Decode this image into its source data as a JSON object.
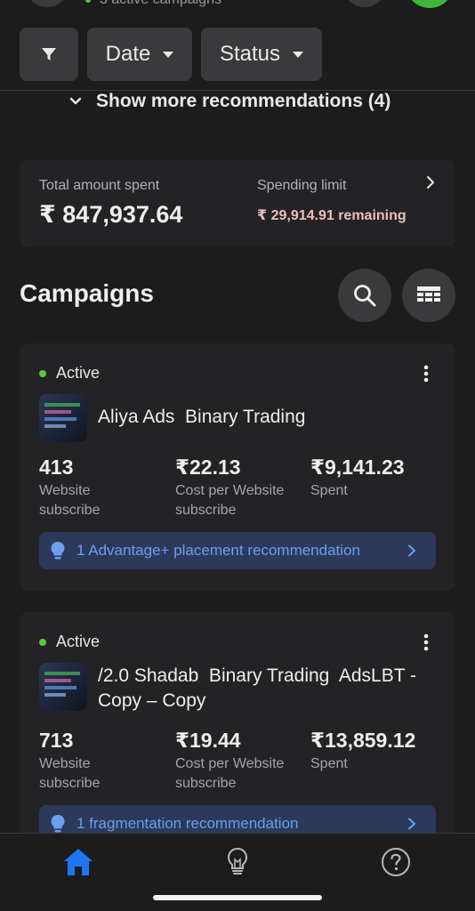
{
  "header": {
    "subtitle_partial": "3 active campaigns"
  },
  "filters": {
    "date_label": "Date",
    "status_label": "Status"
  },
  "recommendations": {
    "show_more_label": "Show more recommendations (4)"
  },
  "spending": {
    "total_label": "Total amount spent",
    "total_value": "₹ 847,937.64",
    "limit_label": "Spending limit",
    "limit_remaining": "₹ 29,914.91 remaining"
  },
  "campaigns": {
    "title": "Campaigns",
    "items": [
      {
        "status": "Active",
        "name": "Aliya Ads  Binary Trading",
        "metrics": [
          {
            "value": "413",
            "label": "Website\nsubscribe"
          },
          {
            "value": "₹22.13",
            "label": "Cost per Website\nsubscribe"
          },
          {
            "value": "₹9,141.23",
            "label": "Spent"
          }
        ],
        "recommendation": "1 Advantage+ placement recommendation"
      },
      {
        "status": "Active",
        "name": "/2.0 Shadab  Binary Trading  AdsLBT -\nCopy – Copy",
        "metrics": [
          {
            "value": "713",
            "label": "Website\nsubscribe"
          },
          {
            "value": "₹19.44",
            "label": "Cost per Website\nsubscribe"
          },
          {
            "value": "₹13,859.12",
            "label": "Spent"
          }
        ],
        "recommendation": "1 fragmentation recommendation"
      }
    ]
  },
  "colors": {
    "accent_blue": "#1f76f2",
    "active_green": "#5cc93b",
    "remaining_red": "#f1bdbc"
  },
  "icons": {
    "filter": "filter-icon",
    "search": "search-icon",
    "grid": "table-icon",
    "home": "home-icon",
    "ideas": "lightbulb-icon",
    "help": "help-icon"
  }
}
